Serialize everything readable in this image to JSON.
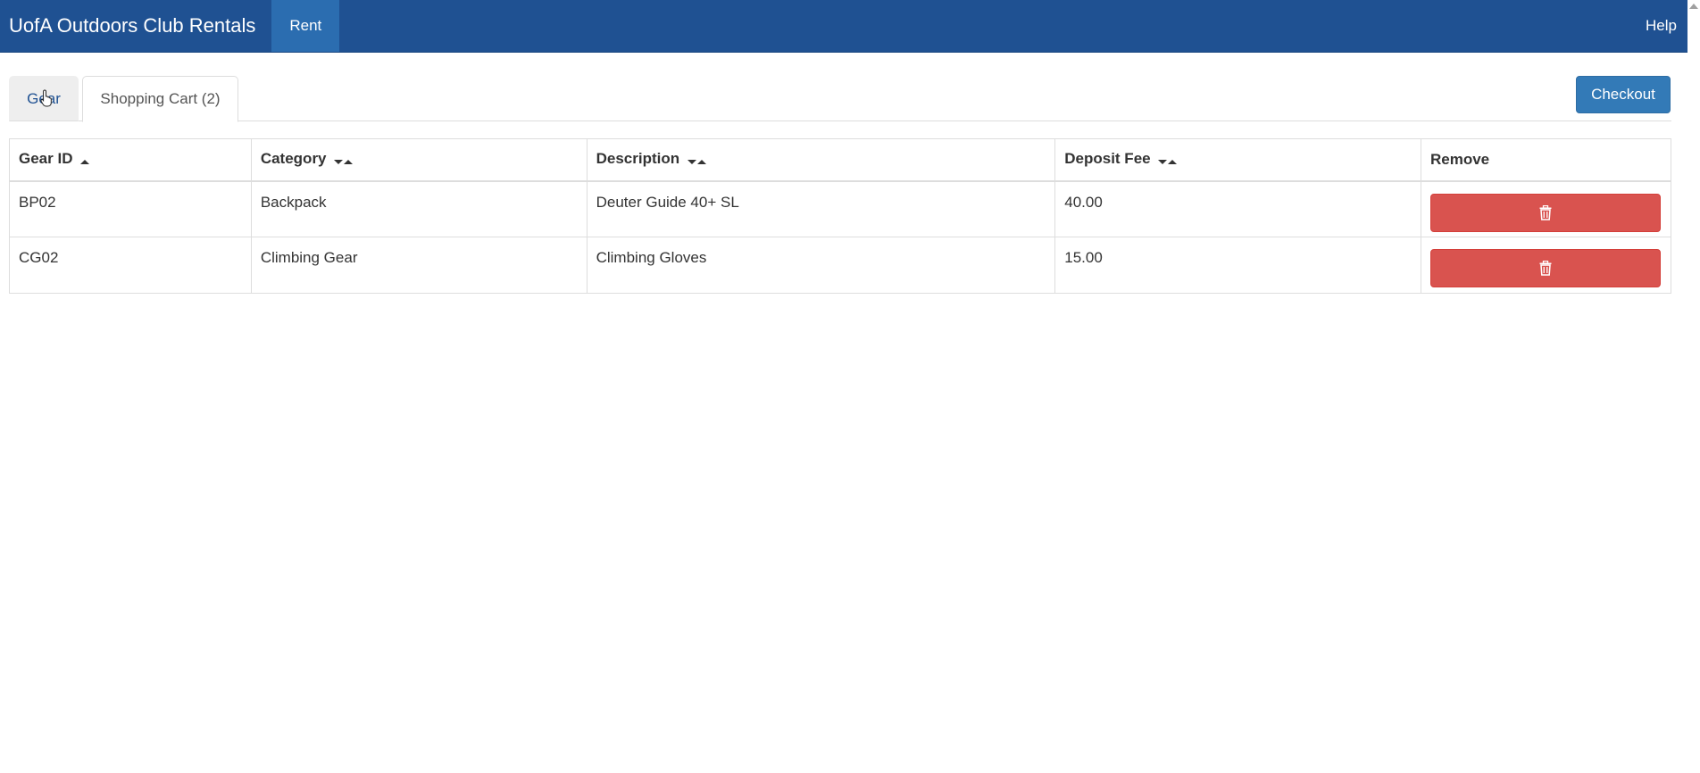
{
  "navbar": {
    "brand": "UofA Outdoors Club Rentals",
    "rent_label": "Rent",
    "help_label": "Help",
    "background": "#1f5192",
    "active_background": "#2b6db0"
  },
  "tabs": {
    "gear_label": "Gear",
    "cart_label": "Shopping Cart (2)"
  },
  "checkout_label": "Checkout",
  "table": {
    "headers": {
      "gear_id": "Gear ID",
      "category": "Category",
      "description": "Description",
      "deposit_fee": "Deposit Fee",
      "remove": "Remove"
    },
    "rows": [
      {
        "gear_id": "BP02",
        "category": "Backpack",
        "description": "Deuter Guide 40+ SL",
        "deposit_fee": "40.00",
        "remove_icon": "trash-icon"
      },
      {
        "gear_id": "CG02",
        "category": "Climbing Gear",
        "description": "Climbing Gloves",
        "deposit_fee": "15.00",
        "remove_icon": "trash-icon"
      }
    ]
  },
  "colors": {
    "primary": "#337ab7",
    "danger": "#d9534f"
  }
}
